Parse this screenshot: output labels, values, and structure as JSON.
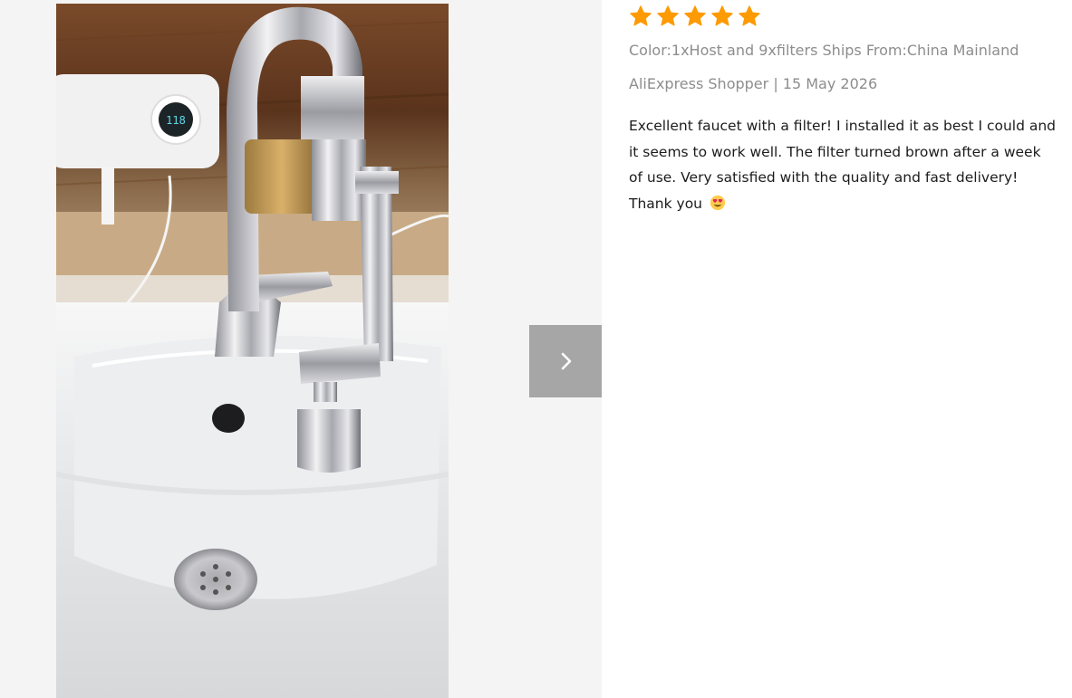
{
  "viewer": {
    "photo_alt": "Review photo: swivel faucet with filter installed on bathroom sink",
    "next_icon": "chevron-right-icon"
  },
  "review": {
    "rating": 5,
    "rating_max": 5,
    "star_color": "#fd9a04",
    "meta_text": "Color:1xHost and 9xfilters Ships From:China Mainland",
    "author": "AliExpress Shopper",
    "separator": "|",
    "date": "15 May 2026",
    "body": "Excellent faucet with a filter! I installed it as best I could and it seems to work well. The filter turned brown after a week of use. Very satisfied with the quality and fast delivery! Thank you",
    "emoji_icon": "smiling-face-with-heart-eyes-icon"
  }
}
